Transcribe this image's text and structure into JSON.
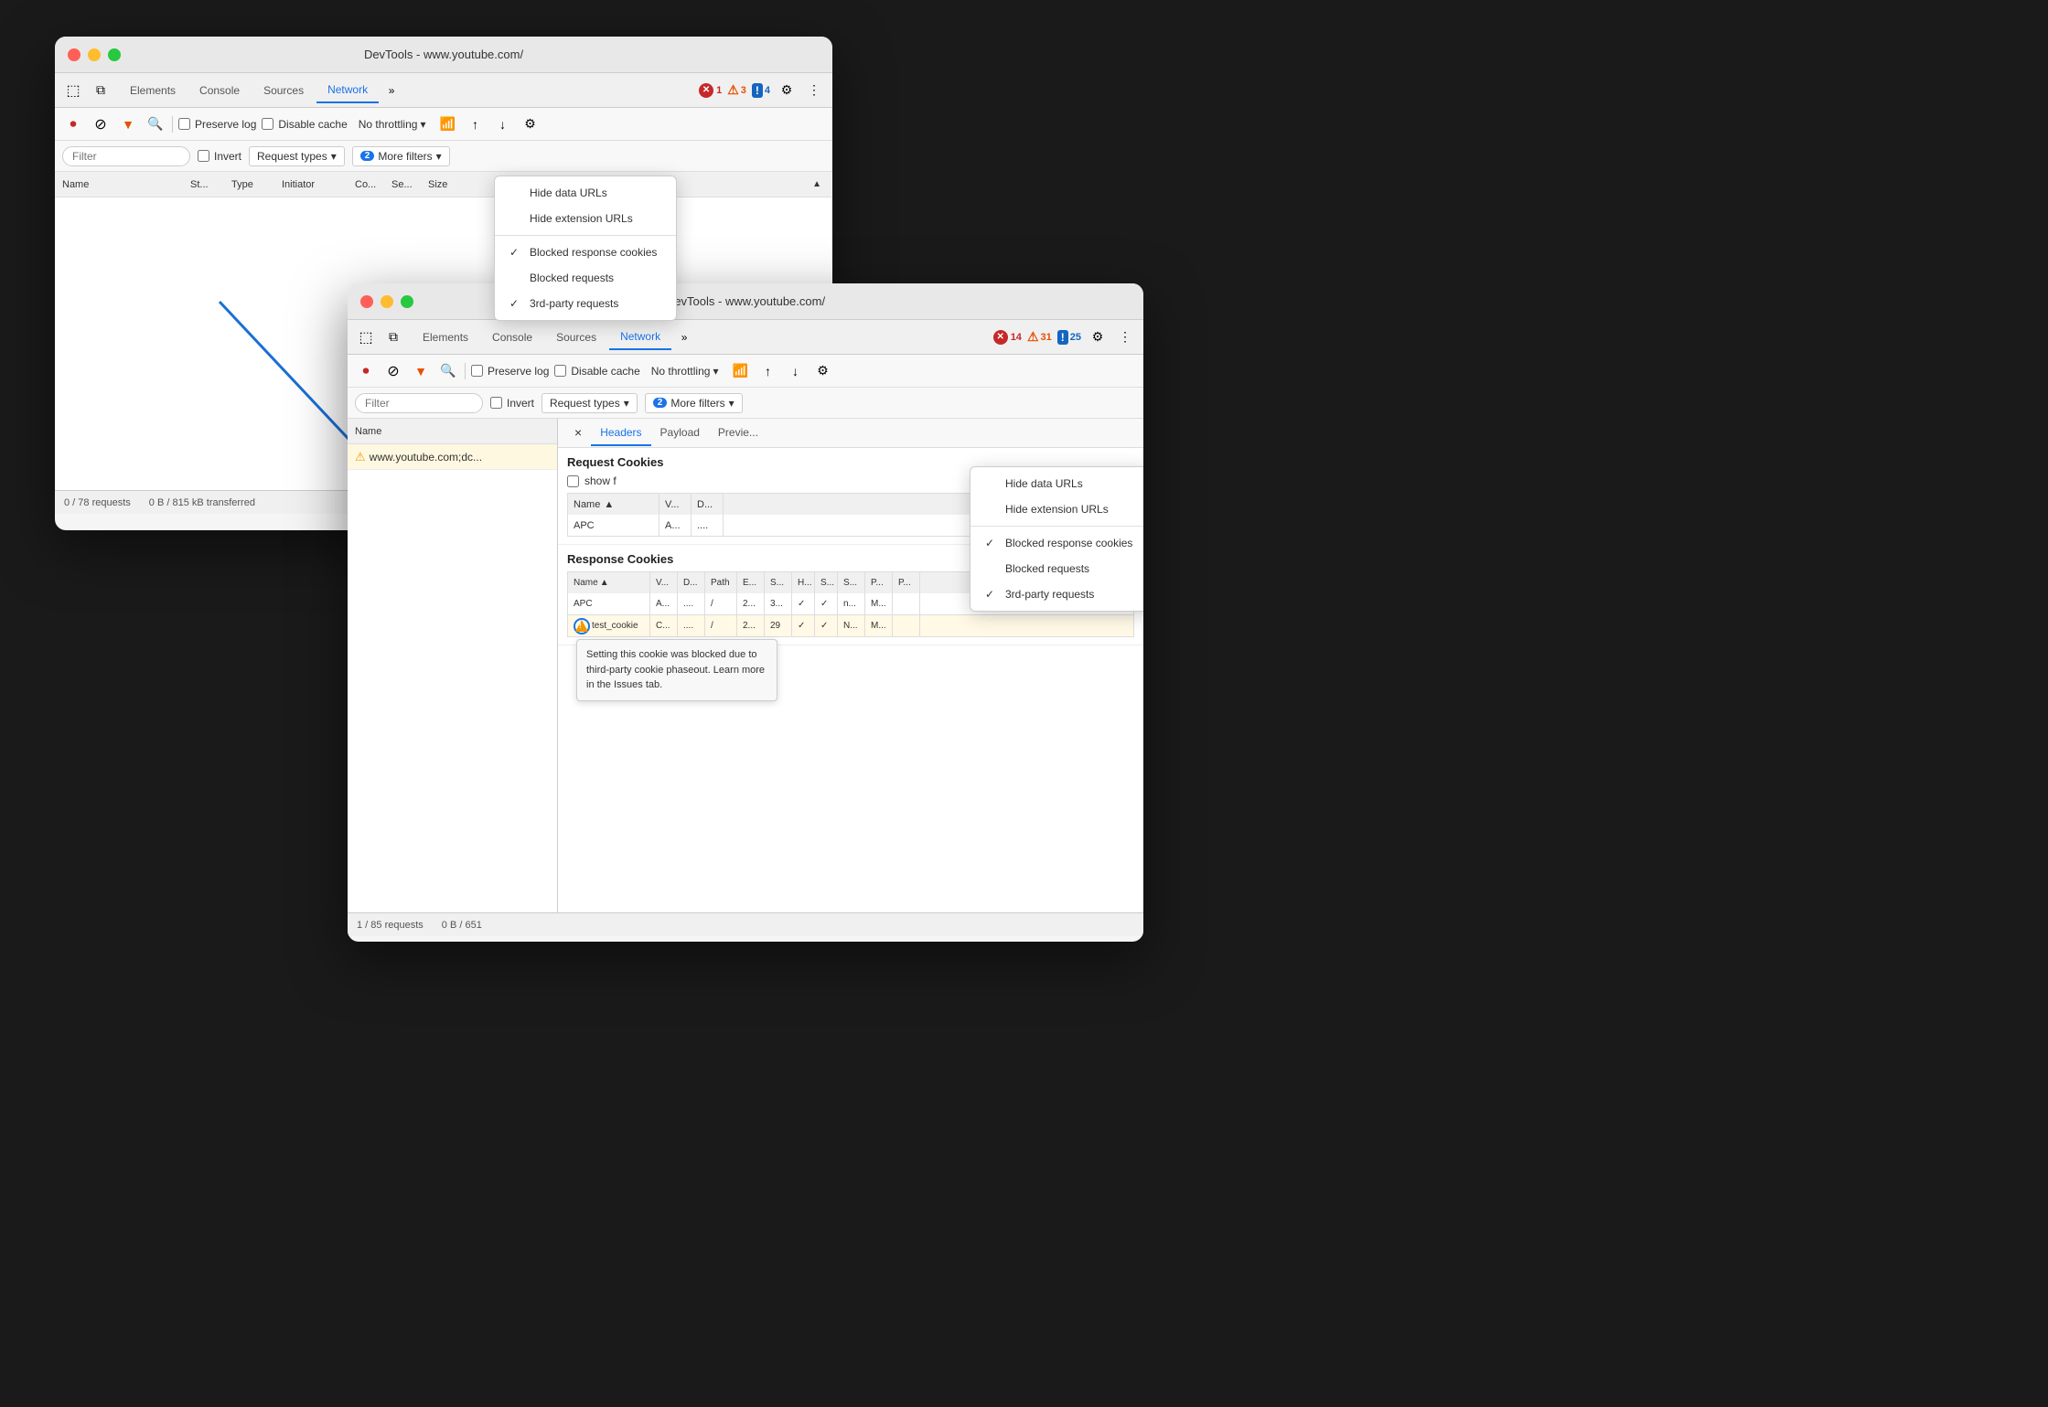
{
  "window1": {
    "title": "DevTools - www.youtube.com/",
    "tabs": [
      "Elements",
      "Console",
      "Sources",
      "Network"
    ],
    "active_tab": "Network",
    "badges": [
      {
        "type": "error",
        "count": "1"
      },
      {
        "type": "warn",
        "count": "3"
      },
      {
        "type": "info",
        "count": "4"
      }
    ],
    "toolbar": {
      "preserve_log": "Preserve log",
      "disable_cache": "Disable cache",
      "throttle": "No throttling"
    },
    "filter_bar": {
      "placeholder": "Filter",
      "invert": "Invert",
      "request_types": "Request types",
      "more_filters_count": "2",
      "more_filters": "More filters"
    },
    "table_columns": [
      "Name",
      "St...",
      "Type",
      "Initiator",
      "Co...",
      "Se...",
      "Size"
    ],
    "status": "0 / 78 requests",
    "transferred": "0 B / 815 kB transferred"
  },
  "window2": {
    "title": "DevTools - www.youtube.com/",
    "tabs": [
      "Elements",
      "Console",
      "Sources",
      "Network"
    ],
    "active_tab": "Network",
    "badges": [
      {
        "type": "error",
        "count": "14"
      },
      {
        "type": "warn",
        "count": "31"
      },
      {
        "type": "info",
        "count": "25"
      }
    ],
    "toolbar": {
      "preserve_log": "Preserve log",
      "disable_cache": "Disable cache",
      "throttle": "No throttling"
    },
    "filter_bar": {
      "placeholder": "Filter",
      "invert": "Invert",
      "request_types": "Request types",
      "more_filters_count": "2",
      "more_filters": "More filters"
    },
    "table_columns": [
      "Name"
    ],
    "request_name": "www.youtube.com;dc...",
    "detail_tabs": [
      "×",
      "Headers",
      "Payload",
      "Previe..."
    ],
    "active_detail_tab": "Headers",
    "request_cookies_title": "Request Cookies",
    "show_filter": "show f",
    "req_cookie_cols": [
      "Name",
      "V...",
      "D..."
    ],
    "req_cookies": [
      {
        "name": "APC",
        "v": "A...",
        "d": "...."
      }
    ],
    "response_cookies_title": "Response Cookies",
    "resp_cookie_cols": [
      "Name",
      "V...",
      "D...",
      "Path",
      "E...",
      "S...",
      "H...",
      "S...",
      "S...",
      "P...",
      "P..."
    ],
    "resp_cookies": [
      {
        "name": "APC",
        "v": "A...",
        "d": "....",
        "path": "/",
        "e": "2...",
        "s": "3...",
        "h": "✓",
        "s2": "✓",
        "s3": "n...",
        "p": "M...",
        "p2": ""
      },
      {
        "name": "test_cookie",
        "v": "C...",
        "d": "....",
        "path": "/",
        "e": "2...",
        "s": "29",
        "h": "✓",
        "s2": "✓",
        "s3": "N...",
        "p": "M...",
        "p2": "",
        "warn": true
      }
    ],
    "tooltip": "Setting this cookie was blocked due to third-party cookie phaseout. Learn more in the Issues tab.",
    "status": "1 / 85 requests",
    "transferred": "0 B / 651"
  },
  "dropdown1": {
    "items": [
      {
        "label": "Hide data URLs",
        "checked": false
      },
      {
        "label": "Hide extension URLs",
        "checked": false
      },
      {
        "separator": true
      },
      {
        "label": "Blocked response cookies",
        "checked": true
      },
      {
        "label": "Blocked requests",
        "checked": false
      },
      {
        "label": "3rd-party requests",
        "checked": true
      }
    ]
  },
  "dropdown2": {
    "items": [
      {
        "label": "Hide data URLs",
        "checked": false
      },
      {
        "label": "Hide extension URLs",
        "checked": false
      },
      {
        "separator": true
      },
      {
        "label": "Blocked response cookies",
        "checked": true
      },
      {
        "label": "Blocked requests",
        "checked": false
      },
      {
        "label": "3rd-party requests",
        "checked": true
      }
    ]
  }
}
